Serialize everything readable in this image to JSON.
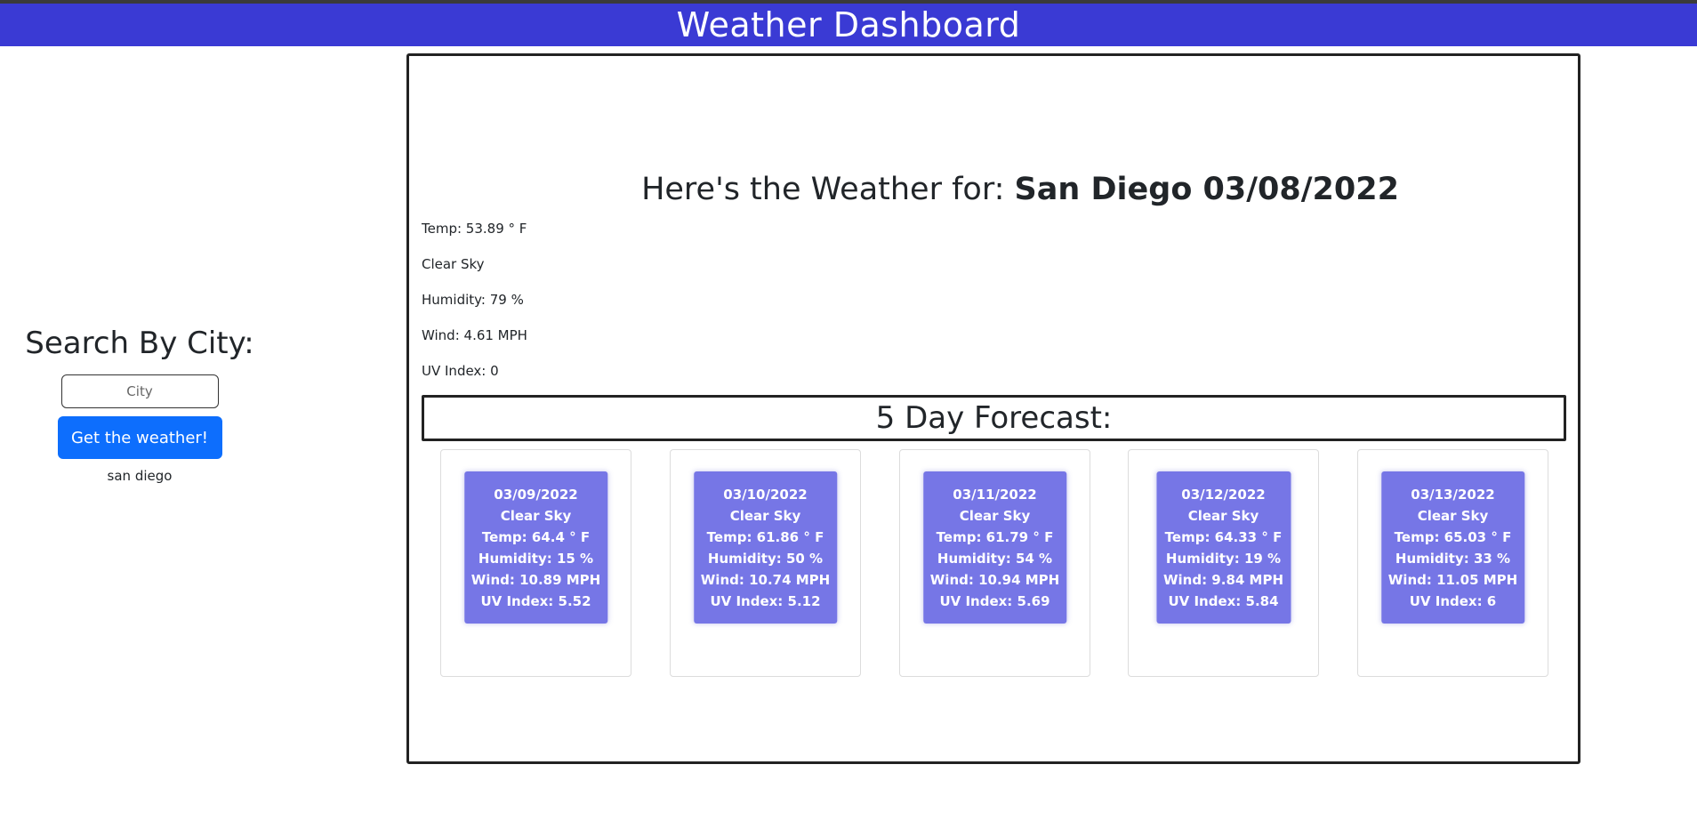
{
  "header": {
    "title": "Weather Dashboard"
  },
  "search": {
    "title": "Search By City:",
    "input_placeholder": "City",
    "input_value": "",
    "button_label": "Get the weather!",
    "history": [
      "san diego"
    ]
  },
  "current": {
    "heading_prefix": "Here's the Weather for: ",
    "heading_city_date": "San Diego 03/08/2022",
    "temp": "Temp: 53.89 ° F",
    "description": "Clear Sky",
    "humidity": "Humidity: 79 %",
    "wind": "Wind: 4.61 MPH",
    "uv": "UV Index: 0"
  },
  "forecast": {
    "title": "5 Day Forecast:",
    "days": [
      {
        "date": "03/09/2022",
        "description": "Clear Sky",
        "temp": "Temp: 64.4 ° F",
        "humidity": "Humidity: 15 %",
        "wind": "Wind: 10.89 MPH",
        "uv": "UV Index: 5.52"
      },
      {
        "date": "03/10/2022",
        "description": "Clear Sky",
        "temp": "Temp: 61.86 ° F",
        "humidity": "Humidity: 50 %",
        "wind": "Wind: 10.74 MPH",
        "uv": "UV Index: 5.12"
      },
      {
        "date": "03/11/2022",
        "description": "Clear Sky",
        "temp": "Temp: 61.79 ° F",
        "humidity": "Humidity: 54 %",
        "wind": "Wind: 10.94 MPH",
        "uv": "UV Index: 5.69"
      },
      {
        "date": "03/12/2022",
        "description": "Clear Sky",
        "temp": "Temp: 64.33 ° F",
        "humidity": "Humidity: 19 %",
        "wind": "Wind: 9.84 MPH",
        "uv": "UV Index: 5.84"
      },
      {
        "date": "03/13/2022",
        "description": "Clear Sky",
        "temp": "Temp: 65.03 ° F",
        "humidity": "Humidity: 33 %",
        "wind": "Wind: 11.05 MPH",
        "uv": "UV Index: 6"
      }
    ]
  },
  "colors": {
    "header_bg": "#3a3ad4",
    "button_bg": "#0d6efd",
    "forecast_card_bg": "#7676e6"
  }
}
